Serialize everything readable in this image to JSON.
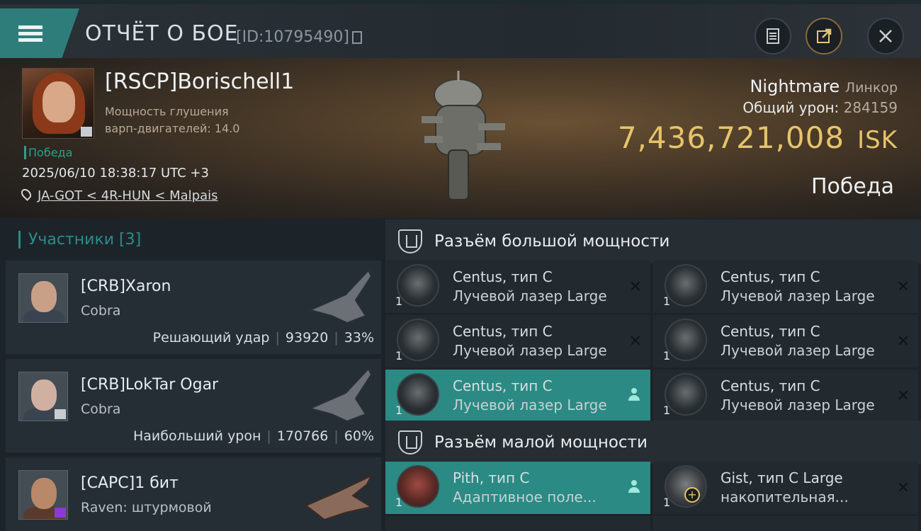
{
  "header": {
    "title": "ОТЧЁТ О БОЕ",
    "report_id": "[ID:10795490]"
  },
  "victim": {
    "name": "[RSCP]Borischell1",
    "stat_line1": "Мощность глушения",
    "stat_line2": "варп-двигателей: 14.0",
    "result_tag": "Победа",
    "datetime": "2025/06/10 18:38:17 UTC +3",
    "location": "JA-GOT < 4R-HUN < Malpais",
    "ship": "Nightmare",
    "ship_class": "Линкор",
    "total_damage_label": "Общий урон:",
    "total_damage": "284159",
    "isk_value": "7,436,721,008",
    "isk_currency": "ISK",
    "outcome": "Победа"
  },
  "participants": {
    "header": "Участники [3]",
    "items": [
      {
        "name": "[CRB]Xaron",
        "ship": "Cobra",
        "role": "Решающий удар",
        "damage": "93920",
        "percent": "33%"
      },
      {
        "name": "[CRB]LokTar Ogar",
        "ship": "Cobra",
        "role": "Наибольший урон",
        "damage": "170766",
        "percent": "60%"
      },
      {
        "name": "[CAPC]1 бит",
        "ship": "Raven: штурмовой"
      }
    ]
  },
  "slots": {
    "high": {
      "label": "Разъём большой мощности",
      "modules": [
        {
          "name": "Centus, тип C",
          "type": "Лучевой лазер Large",
          "qty": "1"
        },
        {
          "name": "Centus, тип C",
          "type": "Лучевой лазер Large",
          "qty": "1"
        },
        {
          "name": "Centus, тип C",
          "type": "Лучевой лазер Large",
          "qty": "1"
        },
        {
          "name": "Centus, тип C",
          "type": "Лучевой лазер Large",
          "qty": "1"
        },
        {
          "name": "Centus, тип C",
          "type": "Лучевой лазер Large",
          "qty": "1"
        },
        {
          "name": "Centus, тип C",
          "type": "Лучевой лазер Large",
          "qty": "1"
        }
      ]
    },
    "low": {
      "label": "Разъём малой мощности",
      "modules": [
        {
          "name": "Pith, тип C",
          "type": "Адаптивное поле...",
          "qty": "1"
        },
        {
          "name": "Gist, тип C Large",
          "type": "накопительная...",
          "qty": "1"
        }
      ]
    }
  },
  "icons": {
    "menu": "menu-icon",
    "copy": "copy-icon",
    "notes": "notes-icon",
    "share": "share-icon",
    "close": "close-icon",
    "location": "location-pin-icon",
    "slot": "shield-icon",
    "remove": "close-x-icon",
    "active_user": "person-icon",
    "add": "plus-icon"
  },
  "colors": {
    "accent_teal": "#2b8a84",
    "isk_gold": "#e6c46a",
    "victory_green": "#2aa08a"
  }
}
